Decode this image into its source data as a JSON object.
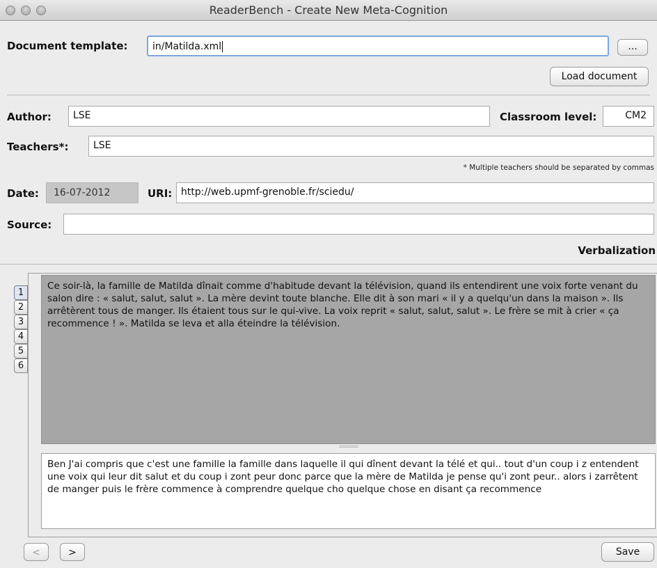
{
  "window": {
    "title": "ReaderBench - Create New Meta-Cognition"
  },
  "template": {
    "label": "Document template:",
    "value": "in/Matilda.xml",
    "browse_label": "...",
    "load_label": "Load document"
  },
  "author": {
    "label": "Author:",
    "value": "LSE"
  },
  "classroom": {
    "label": "Classroom level:",
    "value": "CM2"
  },
  "teachers": {
    "label": "Teachers*:",
    "value": "LSE",
    "note": "* Multiple teachers should be separated by commas"
  },
  "date": {
    "label": "Date:",
    "value": "16-07-2012"
  },
  "uri": {
    "label": "URI:",
    "value": "http://web.upmf-grenoble.fr/sciedu/"
  },
  "source": {
    "label": "Source:",
    "value": ""
  },
  "verbalization": {
    "heading": "Verbalization",
    "tabs": [
      "1",
      "2",
      "3",
      "4",
      "5",
      "6"
    ],
    "active_tab": "1",
    "text": "Ce soir-là, la famille de Matilda dînait comme d'habitude devant la télévision, quand ils entendirent une voix forte venant du salon dire : « salut, salut, salut ». La mère devint toute blanche. Elle dit à son mari « il y a quelqu'un dans la maison ». Ils arrêtèrent tous de manger. Ils étaient tous sur le qui-vive. La voix reprit « salut, salut, salut ». Le frère se mit à crier « ça recommence ! ». Matilda se leva et alla éteindre la télévision.",
    "answer": "Ben J'ai compris que c'est une famille la famille dans laquelle il  qui dînent devant la télé et qui..  tout d'un coup i z entendent une voix qui leur dit salut et du coup i zont peur donc parce que la mère de Matilda je pense qu'i zont peur.. alors i zarrêtent de manger puis le frère  commence à comprendre quelque cho quelque chose en disant ça recommence"
  },
  "nav": {
    "prev_label": "<",
    "next_label": ">",
    "save_label": "Save"
  },
  "colors": {
    "passage_bg": "#a6a6a6",
    "window_bg": "#ececec"
  }
}
